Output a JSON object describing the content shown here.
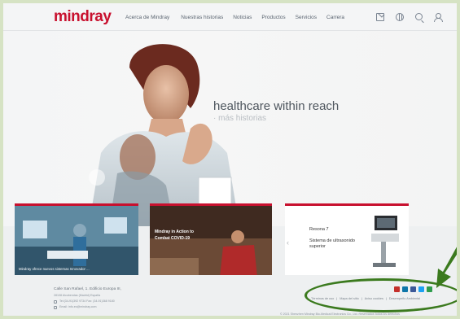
{
  "header": {
    "logo": "mindray",
    "nav": [
      "Acerca de Mindray",
      "Nuestras historias",
      "Noticias",
      "Productos",
      "Servicios",
      "Carrera"
    ],
    "icons": [
      "mail-icon",
      "globe-icon",
      "search-icon",
      "user-icon"
    ]
  },
  "hero": {
    "title": "healthcare within reach",
    "subtitle": "· más historias"
  },
  "cards": [
    {
      "caption": "Mindray ofrece nuevos sistemas Innovador ..."
    },
    {
      "headline": "Mindray in Action to Combat COVID-19"
    },
    {
      "title": "Resona 7",
      "text": "Sistema de ultrasonido superior"
    }
  ],
  "footer": {
    "address_line1": "Calle San Rafael, 1. Edificio Europa III,",
    "address_line2": "28108 Alcobendas (Madrid) España",
    "phone": "Tel:(34-91)392 9734   Fax: (34-91)368 9180",
    "email": "Email: info.es@mindray.com",
    "links": [
      "Términos de uso",
      "Mapa del sitio",
      "Aviso cookies",
      "Desempeño Ambiental"
    ],
    "copyright": "© 2021 Shenzhen Mindray Bio-Medical Electronics Co., Ltd. Reservados todos los derechos",
    "social_colors": [
      "#c4302b",
      "#0e76a8",
      "#3b5998",
      "#1da1f2",
      "#2e9c4c"
    ]
  },
  "colors": {
    "brand": "#c8102e",
    "annotation": "#3b7a1e"
  }
}
